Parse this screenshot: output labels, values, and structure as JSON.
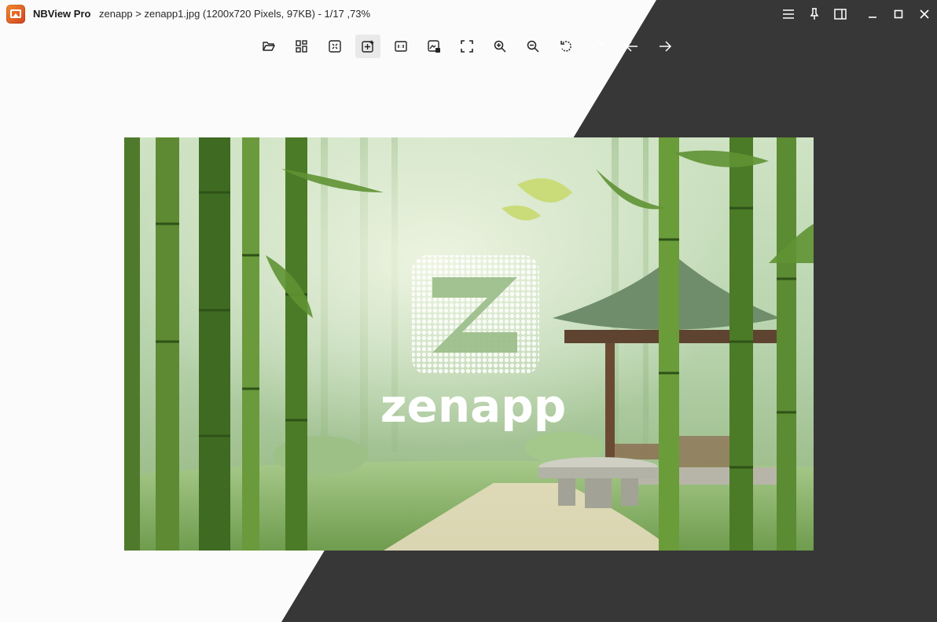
{
  "window": {
    "app_name": "NBView Pro",
    "title": "zenapp > zenapp1.jpg (1200x720 Pixels, 97KB) -  1/17 ,73%"
  },
  "window_controls": [
    {
      "name": "menu-icon"
    },
    {
      "name": "pin-icon"
    },
    {
      "name": "sidebar-toggle-icon"
    },
    {
      "name": "minimize-icon"
    },
    {
      "name": "maximize-icon"
    },
    {
      "name": "close-icon"
    }
  ],
  "toolbar": {
    "tools": [
      {
        "name": "open-folder-icon"
      },
      {
        "name": "thumbnail-grid-icon"
      },
      {
        "name": "fit-to-window-icon"
      },
      {
        "name": "auto-fit-icon",
        "active": true
      },
      {
        "name": "actual-size-icon"
      },
      {
        "name": "image-info-icon"
      },
      {
        "name": "fullscreen-icon"
      },
      {
        "name": "zoom-in-icon"
      },
      {
        "name": "zoom-out-icon"
      },
      {
        "name": "rotate-left-icon"
      },
      {
        "name": "rotate-right-icon"
      },
      {
        "name": "previous-image-icon"
      },
      {
        "name": "next-image-icon"
      }
    ]
  },
  "image": {
    "logo_text": "zenapp"
  },
  "colors": {
    "dark_panel": "#373737",
    "light_panel": "#fbfbfb",
    "icon": "#222222"
  }
}
